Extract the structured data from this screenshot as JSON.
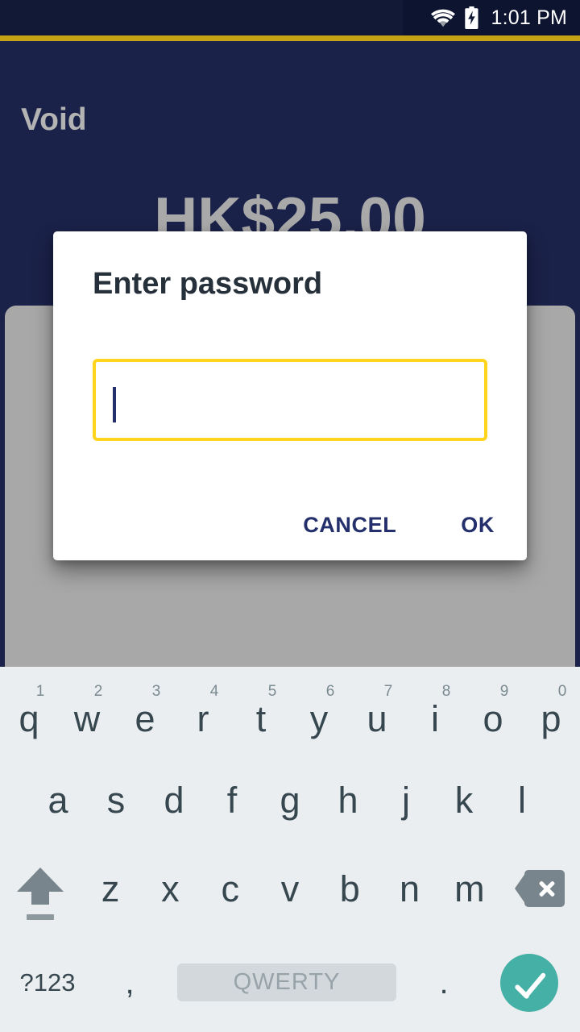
{
  "status_bar": {
    "time": "1:01 PM",
    "wifi_icon": "wifi-icon",
    "battery_icon": "battery-charging-icon",
    "background_color": "#0d1430"
  },
  "accent_rule_color": "#c6a215",
  "app": {
    "title": "Void",
    "amount": "HK$25.00",
    "background_color": "#1b2249",
    "panel_color": "#a8a8a8"
  },
  "dialog": {
    "title": "Enter password",
    "input": {
      "value": "",
      "placeholder": "",
      "border_color": "#ffd41f",
      "caret_color": "#24306b"
    },
    "cancel_label": "CANCEL",
    "ok_label": "OK",
    "action_color": "#24306b"
  },
  "keyboard": {
    "background_color": "#eaeef0",
    "key_text_color": "#37474f",
    "hint_color": "#7a8a91",
    "modifier_color": "#78858c",
    "enter_color": "#45b0a5",
    "row1": [
      {
        "label": "q",
        "hint": "1"
      },
      {
        "label": "w",
        "hint": "2"
      },
      {
        "label": "e",
        "hint": "3"
      },
      {
        "label": "r",
        "hint": "4"
      },
      {
        "label": "t",
        "hint": "5"
      },
      {
        "label": "y",
        "hint": "6"
      },
      {
        "label": "u",
        "hint": "7"
      },
      {
        "label": "i",
        "hint": "8"
      },
      {
        "label": "o",
        "hint": "9"
      },
      {
        "label": "p",
        "hint": "0"
      }
    ],
    "row2": [
      {
        "label": "a"
      },
      {
        "label": "s"
      },
      {
        "label": "d"
      },
      {
        "label": "f"
      },
      {
        "label": "g"
      },
      {
        "label": "h"
      },
      {
        "label": "j"
      },
      {
        "label": "k"
      },
      {
        "label": "l"
      }
    ],
    "row3": [
      {
        "label": "z"
      },
      {
        "label": "x"
      },
      {
        "label": "c"
      },
      {
        "label": "v"
      },
      {
        "label": "b"
      },
      {
        "label": "n"
      },
      {
        "label": "m"
      }
    ],
    "shift_icon": "shift-icon",
    "backspace_icon": "backspace-icon",
    "symbols_label": "?123",
    "comma_label": ",",
    "space_label": "QWERTY",
    "period_label": ".",
    "enter_icon": "check-icon"
  }
}
